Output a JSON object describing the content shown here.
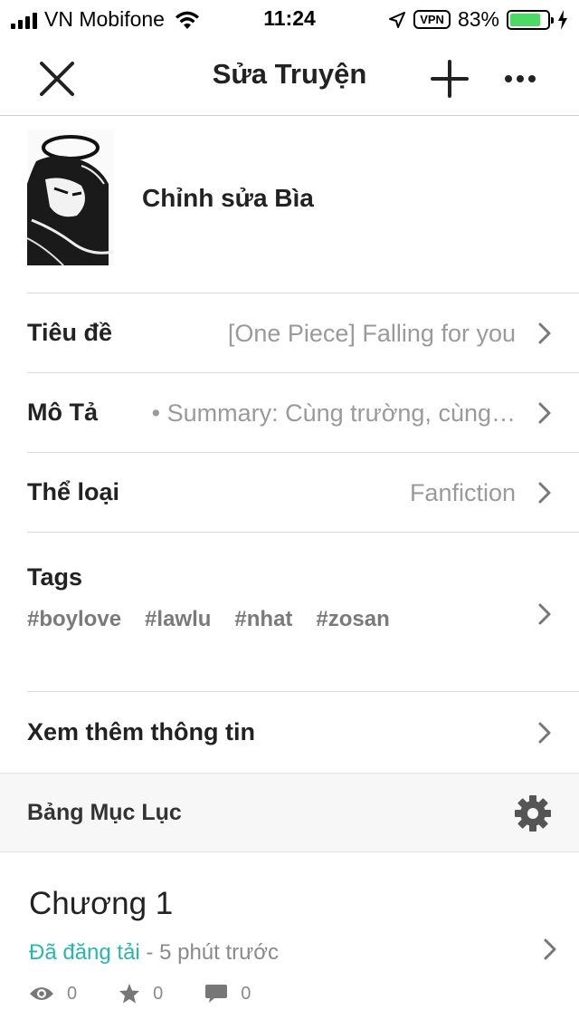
{
  "status_bar": {
    "carrier": "VN Mobifone",
    "time": "11:24",
    "vpn": "VPN",
    "battery_percent": "83%",
    "battery_level": 0.83
  },
  "nav": {
    "title": "Sửa Truyện",
    "close_icon": "close-icon",
    "add_icon": "plus-icon",
    "more_icon": "more-icon"
  },
  "cover": {
    "label": "Chỉnh sửa Bìa"
  },
  "fields": {
    "title": {
      "label": "Tiêu đề",
      "value": "[One Piece] Falling for you"
    },
    "description": {
      "label": "Mô Tả",
      "value": "• Summary: Cùng trường, cùng…"
    },
    "genre": {
      "label": "Thể loại",
      "value": "Fanfiction"
    },
    "tags": {
      "label": "Tags",
      "items": [
        "#boylove",
        "#lawlu",
        "#nhat",
        "#zosan"
      ]
    },
    "more_info": {
      "label": "Xem thêm thông tin"
    }
  },
  "toc": {
    "title": "Bảng Mục Lục"
  },
  "chapter": {
    "title": "Chương 1",
    "status": "Đã đăng tải",
    "time": " - 5 phút trước",
    "views": "0",
    "votes": "0",
    "comments": "0"
  },
  "colors": {
    "accent": "#2bb5b0",
    "battery": "#4cd964"
  }
}
